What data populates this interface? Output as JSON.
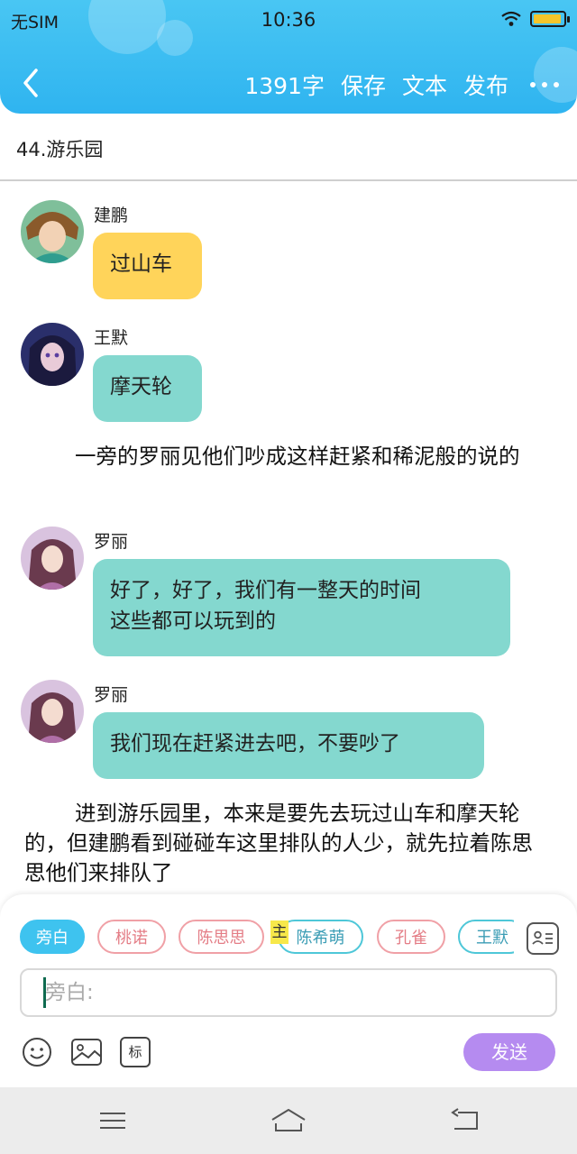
{
  "status": {
    "carrier": "无SIM",
    "time": "10:36"
  },
  "toolbar": {
    "word_count": "1391字",
    "save": "保存",
    "text": "文本",
    "publish": "发布"
  },
  "chapter": {
    "title": "44.游乐园"
  },
  "messages": [
    {
      "speaker": "建鹏",
      "text": "过山车",
      "color": "#ffd45a"
    },
    {
      "speaker": "王默",
      "text": "摩天轮",
      "color": "#84d8cf"
    },
    {
      "speaker": "罗丽",
      "text_lines": [
        "好了，好了，我们有一整天的时间",
        "这些都可以玩到的"
      ],
      "color": "#84d8cf"
    },
    {
      "speaker": "罗丽",
      "text": "我们现在赶紧进去吧，不要吵了",
      "color": "#84d8cf"
    }
  ],
  "narrations": [
    "一旁的罗丽见他们吵成这样赶紧和稀泥般的说的",
    "进到游乐园里，本来是要先去玩过山车和摩天轮的，但建鹏看到碰碰车这里排队的人少，就先拉着陈思思他们来排队了"
  ],
  "roles": [
    {
      "label": "旁白"
    },
    {
      "label": "桃诺"
    },
    {
      "label": "陈思思"
    },
    {
      "label": "陈希萌"
    },
    {
      "label": "孔雀"
    },
    {
      "label": "王默"
    }
  ],
  "main_tag": "主",
  "composer": {
    "placeholder": "旁白:",
    "send": "发送",
    "mark_label": "标"
  },
  "icons": [
    "back-arrow-icon",
    "more-icon",
    "wifi-icon",
    "battery-icon",
    "contact-card-icon",
    "emoji-icon",
    "image-icon",
    "mark-icon",
    "menu-icon",
    "home-icon",
    "back-icon"
  ],
  "colors": {
    "header": "#2fb4f0",
    "accent": "#3ec3ef",
    "send": "#b58bf0",
    "bubble_yellow": "#ffd45a",
    "bubble_teal": "#84d8cf"
  }
}
